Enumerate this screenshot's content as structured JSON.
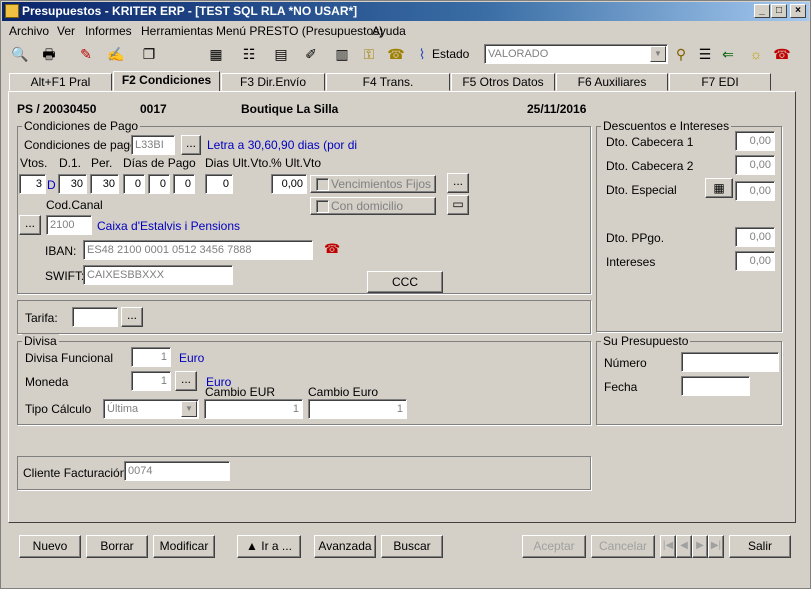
{
  "window": {
    "title": "Presupuestos - KRITER ERP - [TEST SQL RLA *NO USAR*]"
  },
  "menu": [
    "Archivo",
    "Ver",
    "Informes",
    "Herramientas",
    "Menú PRESTO (Presupuestos)",
    "Ayuda"
  ],
  "toolbar": {
    "estado_label": "Estado",
    "estado_value": "VALORADO"
  },
  "tabs": [
    "Alt+F1 Pral",
    "F2 Condiciones",
    "F3 Dir.Envío",
    "F4 Trans.",
    "F5 Otros Datos",
    "F6 Auxiliares",
    "F7 EDI"
  ],
  "header": {
    "doc": "PS / 20030450",
    "code": "0017",
    "name": "Boutique La Silla",
    "date": "25/11/2016"
  },
  "pago": {
    "group": "Condiciones de Pago",
    "cond_label": "Condiciones de pago",
    "cond_value": "L33BI",
    "cond_desc": "Letra a 30,60,90 dias (por di",
    "vtos_label": "Vtos.",
    "d1_label": "D.1.",
    "per_label": "Per.",
    "dias_label": "Días de Pago",
    "ult_label": "Dias Ult.Vto.",
    "pct_label": "% Ult.Vto",
    "vtos": "3",
    "d_mark": "D",
    "d1": "30",
    "per": "30",
    "dia1": "0",
    "dia2": "0",
    "dia3": "0",
    "ult": "0",
    "pct": "0,00",
    "venc_label": "Vencimientos Fijos",
    "domicilio_label": "Con domicilio",
    "canal_label": "Cod.Canal",
    "canal_value": "2100",
    "canal_desc": "Caixa d'Estalvis i Pensions",
    "iban_label": "IBAN:",
    "iban_value": "ES48 2100 0001 0512 3456 7888",
    "swift_label": "SWIFT:",
    "swift_value": "CAIXESBBXXX",
    "ccc_label": "CCC"
  },
  "tarifa": {
    "label": "Tarifa:",
    "value": ""
  },
  "divisa": {
    "group": "Divisa",
    "func_label": "Divisa Funcional",
    "func_value": "1",
    "func_desc": "Euro",
    "moneda_label": "Moneda",
    "moneda_value": "1",
    "moneda_desc": "Euro",
    "cambio_eur_label": "Cambio EUR",
    "cambio_eur": "1",
    "cambio_euro_label": "Cambio Euro",
    "cambio_euro": "1",
    "tipo_label": "Tipo Cálculo",
    "tipo_value": "Última"
  },
  "cliente": {
    "label": "Cliente Facturación",
    "value": "0074"
  },
  "descuentos": {
    "group": "Descuentos e Intereses",
    "cab1_label": "Dto. Cabecera 1",
    "cab1": "0,00",
    "cab2_label": "Dto. Cabecera 2",
    "cab2": "0,00",
    "esp_label": "Dto. Especial",
    "esp": "0,00",
    "ppgo_label": "Dto. PPgo.",
    "ppgo": "0,00",
    "int_label": "Intereses",
    "int": "0,00"
  },
  "supres": {
    "group": "Su Presupuesto",
    "num_label": "Número",
    "num": "",
    "fecha_label": "Fecha",
    "fecha": ""
  },
  "buttons": {
    "nuevo": "Nuevo",
    "borrar": "Borrar",
    "modificar": "Modificar",
    "ira": "▲ Ir a ...",
    "avanzada": "Avanzada",
    "buscar": "Buscar",
    "aceptar": "Aceptar",
    "cancelar": "Cancelar",
    "salir": "Salir"
  },
  "icons": [
    "preview-icon",
    "print-icon",
    "wand-icon",
    "edit-icon",
    "copy-icon",
    "calculator-icon",
    "tree-icon",
    "grid-icon",
    "notes-icon",
    "chart-icon",
    "key-icon",
    "phone-icon",
    "paperclip-icon",
    "lamp-icon",
    "help-icon"
  ]
}
